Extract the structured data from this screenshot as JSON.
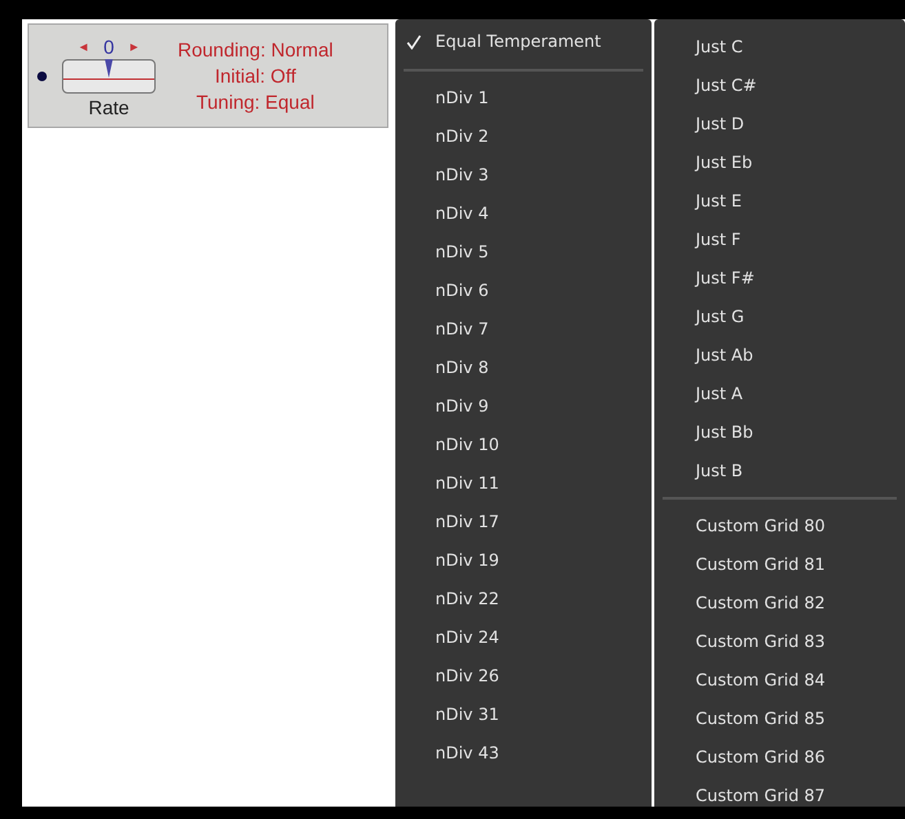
{
  "control": {
    "arrow_left": "◄",
    "value": "0",
    "arrow_right": "►",
    "label": "Rate",
    "level": 0.5,
    "status": [
      "Rounding: Normal",
      "Initial: Off",
      "Tuning: Equal"
    ]
  },
  "menu": {
    "sections": [
      [
        {
          "label": "Equal Temperament",
          "checked": true
        }
      ],
      [
        {
          "label": "nDiv 1",
          "checked": false
        },
        {
          "label": "nDiv 2",
          "checked": false
        },
        {
          "label": "nDiv 3",
          "checked": false
        },
        {
          "label": "nDiv 4",
          "checked": false
        },
        {
          "label": "nDiv 5",
          "checked": false
        },
        {
          "label": "nDiv 6",
          "checked": false
        },
        {
          "label": "nDiv 7",
          "checked": false
        },
        {
          "label": "nDiv 8",
          "checked": false
        },
        {
          "label": "nDiv 9",
          "checked": false
        },
        {
          "label": "nDiv 10",
          "checked": false
        },
        {
          "label": "nDiv 11",
          "checked": false
        },
        {
          "label": "nDiv 17",
          "checked": false
        },
        {
          "label": "nDiv 19",
          "checked": false
        },
        {
          "label": "nDiv 22",
          "checked": false
        },
        {
          "label": "nDiv 24",
          "checked": false
        },
        {
          "label": "nDiv 26",
          "checked": false
        },
        {
          "label": "nDiv 31",
          "checked": false
        },
        {
          "label": "nDiv 43",
          "checked": false
        }
      ]
    ]
  },
  "submenu": {
    "sections": [
      [
        "Just C",
        "Just C#",
        "Just D",
        "Just Eb",
        "Just E",
        "Just F",
        "Just F#",
        "Just G",
        "Just Ab",
        "Just A",
        "Just Bb",
        "Just B"
      ],
      [
        "Custom Grid 80",
        "Custom Grid 81",
        "Custom Grid 82",
        "Custom Grid 83",
        "Custom Grid 84",
        "Custom Grid 85",
        "Custom Grid 86",
        "Custom Grid 87"
      ]
    ]
  }
}
